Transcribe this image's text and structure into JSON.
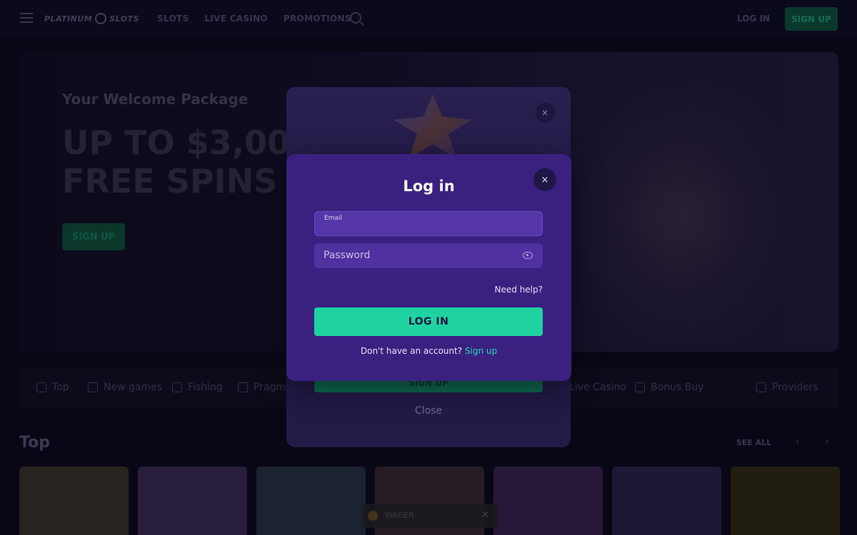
{
  "topbar": {
    "logo_left": "PLATINUM",
    "logo_right": "SLOTS",
    "nav": [
      "SLOTS",
      "LIVE CASINO",
      "PROMOTIONS"
    ],
    "login_label": "LOG IN",
    "signup_label": "SIGN UP"
  },
  "hero": {
    "subtitle": "Your Welcome Package",
    "title": "UP TO $3,000 + FREE SPINS",
    "button": "SIGN UP"
  },
  "categories": [
    "Top",
    "New games",
    "Fishing",
    "Pragmatic",
    "Live Casino",
    "Bonus Buy",
    "Providers"
  ],
  "section": {
    "title": "Top",
    "see_all": "SEE ALL",
    "prev": "‹",
    "next": "›"
  },
  "games": [
    {
      "color": "#2a2520"
    },
    {
      "color": "#2b2040"
    },
    {
      "color": "#1e2533"
    },
    {
      "color": "#2a1e28"
    },
    {
      "color": "#2a1a3a"
    },
    {
      "color": "#1f1a38"
    },
    {
      "color": "#241f14"
    }
  ],
  "back_modal": {
    "close_icon": "×",
    "green_button": "SIGN UP",
    "close_text": "Close"
  },
  "login_modal": {
    "title": "Log in",
    "close_icon": "×",
    "email_label": "Email",
    "email_value": "",
    "password_placeholder": "Password",
    "need_help": "Need help?",
    "login_button": "LOG IN",
    "no_account": "Don't have an account?",
    "signup_link": "Sign up"
  },
  "toast": {
    "text": "WAGER",
    "close": "×"
  },
  "colors": {
    "modal_bg": "#3a2180",
    "input_bg": "#5233a2",
    "accent": "#1fd3a1",
    "page_bg": "#0a0818"
  }
}
